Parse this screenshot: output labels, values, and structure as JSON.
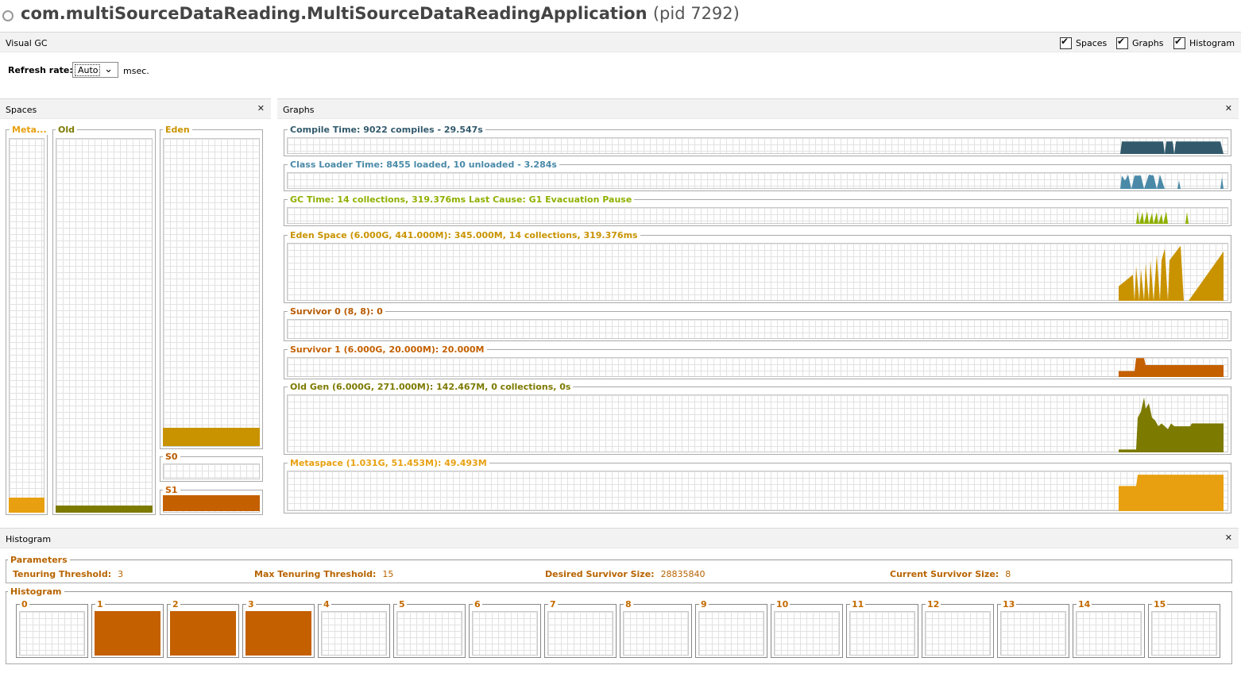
{
  "app": {
    "title": "com.multiSourceDataReading.MultiSourceDataReadingApplication",
    "pid": "(pid 7292)"
  },
  "toolbar": {
    "label": "Visual GC",
    "spaces_label": "Spaces",
    "graphs_label": "Graphs",
    "histogram_label": "Histogram",
    "spaces_checked": true,
    "graphs_checked": true,
    "histogram_checked": true
  },
  "refresh": {
    "label": "Refresh rate:",
    "value": "Auto",
    "unit": "msec."
  },
  "spaces_panel": {
    "title": "Spaces",
    "meta": {
      "label": "Meta...",
      "fill_fraction": 0.04,
      "color": "#e8a010"
    },
    "old": {
      "label": "Old",
      "fill_fraction": 0.02,
      "color": "#7d7a00"
    },
    "eden": {
      "label": "Eden",
      "fill_fraction": 0.06,
      "color": "#c99300"
    },
    "s0": {
      "label": "S0",
      "fill_fraction": 0.0,
      "color": "#c46000"
    },
    "s1": {
      "label": "S1",
      "fill_fraction": 1.0,
      "color": "#c46000"
    }
  },
  "graphs_panel": {
    "title": "Graphs",
    "graphs": [
      {
        "label": "Compile Time: 9022 compiles - 29.547s",
        "color": "#325a6c"
      },
      {
        "label": "Class Loader Time: 8455 loaded, 10 unloaded - 3.284s",
        "color": "#4a8aa8"
      },
      {
        "label": "GC Time: 14 collections, 319.376ms Last Cause: G1 Evacuation Pause",
        "color": "#8fb000"
      },
      {
        "label": "Eden Space (6.000G, 441.000M): 345.000M, 14 collections, 319.376ms",
        "color": "#c99300"
      },
      {
        "label": "Survivor 0 (8, 8): 0",
        "color": "#b85a00"
      },
      {
        "label": "Survivor 1 (6.000G, 20.000M): 20.000M",
        "color": "#c46000"
      },
      {
        "label": "Old Gen (6.000G, 271.000M): 142.467M, 0 collections, 0s",
        "color": "#7d7a00"
      },
      {
        "label": "Metaspace (1.031G, 51.453M): 49.493M",
        "color": "#e8a010"
      }
    ]
  },
  "histogram_panel": {
    "title": "Histogram",
    "parameters_title": "Parameters",
    "tenuring_threshold_label": "Tenuring Threshold:",
    "tenuring_threshold_value": "3",
    "max_tenuring_threshold_label": "Max Tenuring Threshold:",
    "max_tenuring_threshold_value": "15",
    "desired_survivor_size_label": "Desired Survivor Size:",
    "desired_survivor_size_value": "28835840",
    "current_survivor_size_label": "Current Survivor Size:",
    "current_survivor_size_value": "8",
    "histogram_title": "Histogram",
    "bins": [
      {
        "label": "0",
        "fill_fraction": 0
      },
      {
        "label": "1",
        "fill_fraction": 1
      },
      {
        "label": "2",
        "fill_fraction": 1
      },
      {
        "label": "3",
        "fill_fraction": 1
      },
      {
        "label": "4",
        "fill_fraction": 0
      },
      {
        "label": "5",
        "fill_fraction": 0
      },
      {
        "label": "6",
        "fill_fraction": 0
      },
      {
        "label": "7",
        "fill_fraction": 0
      },
      {
        "label": "8",
        "fill_fraction": 0
      },
      {
        "label": "9",
        "fill_fraction": 0
      },
      {
        "label": "10",
        "fill_fraction": 0
      },
      {
        "label": "11",
        "fill_fraction": 0
      },
      {
        "label": "12",
        "fill_fraction": 0
      },
      {
        "label": "13",
        "fill_fraction": 0
      },
      {
        "label": "14",
        "fill_fraction": 0
      },
      {
        "label": "15",
        "fill_fraction": 0
      }
    ],
    "bin_color": "#c46000"
  },
  "icons": {
    "status": "ring-icon",
    "close": "close-icon",
    "checkbox": "checkbox-icon",
    "dropdown": "chevron-down-icon"
  }
}
